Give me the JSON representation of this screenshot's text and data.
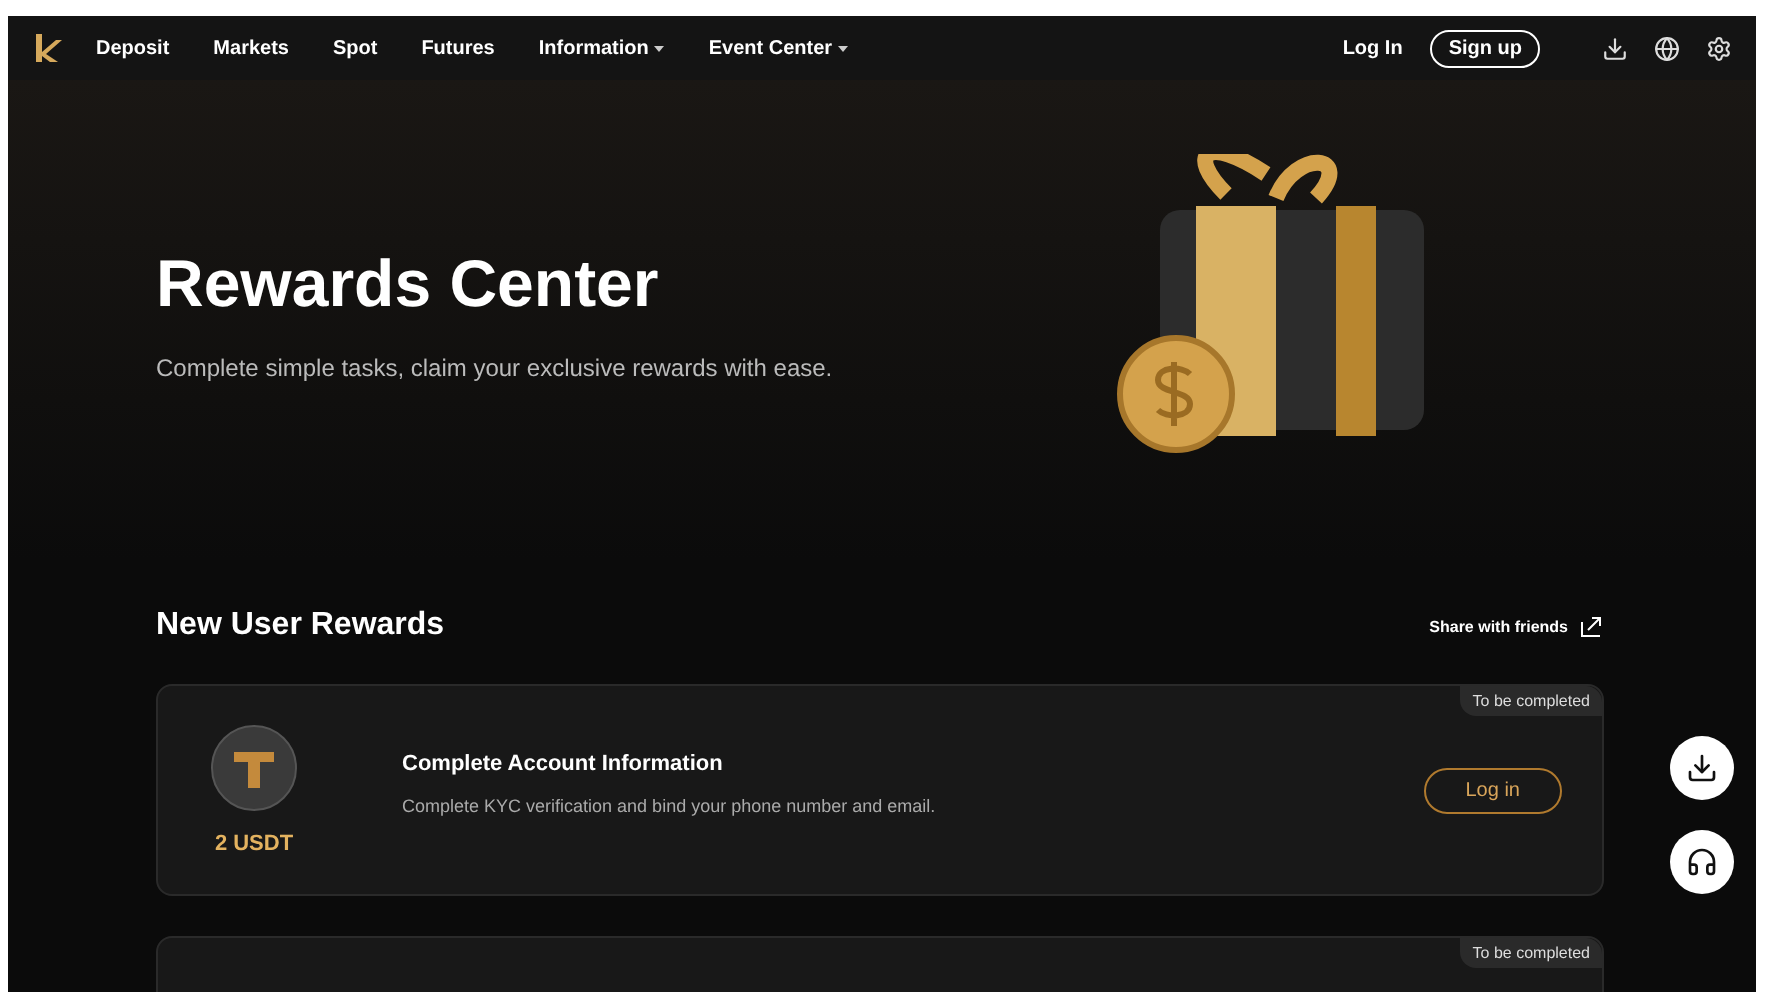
{
  "nav": {
    "items": [
      {
        "label": "Deposit",
        "dropdown": false
      },
      {
        "label": "Markets",
        "dropdown": false
      },
      {
        "label": "Spot",
        "dropdown": false
      },
      {
        "label": "Futures",
        "dropdown": false
      },
      {
        "label": "Information",
        "dropdown": true
      },
      {
        "label": "Event Center",
        "dropdown": true
      }
    ],
    "login": "Log In",
    "signup": "Sign up"
  },
  "hero": {
    "title": "Rewards Center",
    "subtitle": "Complete simple tasks, claim your exclusive rewards with ease."
  },
  "section": {
    "title": "New User Rewards",
    "share": "Share with friends"
  },
  "tasks": [
    {
      "status": "To be completed",
      "reward": "2 USDT",
      "title": "Complete Account Information",
      "description": "Complete KYC verification and bind your phone number and email.",
      "action": "Log in"
    },
    {
      "status": "To be completed"
    }
  ]
}
